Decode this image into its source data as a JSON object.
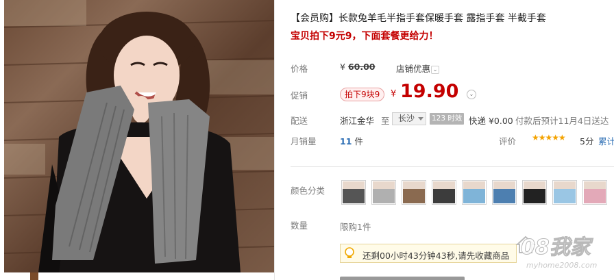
{
  "product": {
    "title": "【会员购】长款兔羊毛半指手套保暖手套 露指手套 半截手套",
    "subtitle": "宝贝拍下9元9，下面套餐更给力！"
  },
  "price_row": {
    "label": "价格",
    "currency": "¥",
    "original_price": "60.00",
    "shop_discount": "店铺优惠",
    "chevron": "⌄"
  },
  "promo_row": {
    "label": "促销",
    "badge": "拍下9块9",
    "currency": "¥",
    "price": "19.90",
    "chevron": "⌄"
  },
  "delivery_row": {
    "label": "配送",
    "origin": "浙江金华",
    "to": "至",
    "city": "长沙",
    "time_badge": "123 时效",
    "shipping": "快递 ¥0.00",
    "estimate": "付款后预计11月4日送达"
  },
  "sales_row": {
    "label": "月销量",
    "count": "11",
    "unit": "件",
    "rating_label": "评价",
    "stars": "★★★★★",
    "score": "5分",
    "cumulative": "累计"
  },
  "color_row": {
    "label": "颜色分类",
    "swatches": [
      "dark-gray",
      "light-gray",
      "brown",
      "charcoal",
      "sky-blue",
      "blue",
      "black",
      "light-blue",
      "pink"
    ]
  },
  "quantity_row": {
    "label": "数量",
    "limit": "限购1件"
  },
  "notice": {
    "text": "还剩00小时43分钟43秒,请先收藏商品"
  },
  "watermark": {
    "brand": "08我家",
    "url": "myhome2008.com"
  },
  "colors": {
    "accent_red": "#c40000",
    "star_orange": "#f4a300"
  }
}
